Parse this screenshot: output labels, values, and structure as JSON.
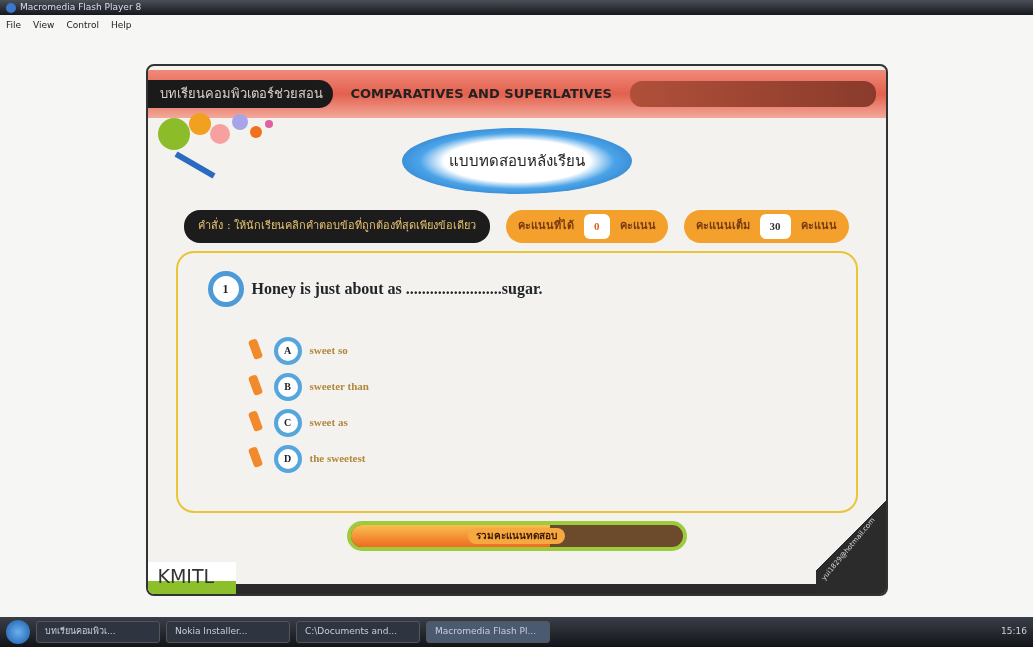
{
  "window": {
    "title": "Macromedia Flash Player 8"
  },
  "menu": [
    "File",
    "View",
    "Control",
    "Help"
  ],
  "header": {
    "tag": "บทเรียนคอมพิวเตอร์ช่วยสอน",
    "title": "COMPARATIVES AND SUPERLATIVES"
  },
  "section_title": "แบบทดสอบหลังเรียน",
  "instruction": "คำสั่ง : ให้นักเรียนคลิกคำตอบข้อที่ถูกต้องที่สุดเพียงข้อเดียว",
  "scores": [
    {
      "label": "คะแนนที่ได้",
      "value": "0",
      "unit": "คะแนน",
      "kind": "earned"
    },
    {
      "label": "คะแนนเต็ม",
      "value": "30",
      "unit": "คะแนน",
      "kind": "total"
    }
  ],
  "question": {
    "number": "1",
    "text": "Honey is just about as ........................sugar."
  },
  "options": [
    {
      "letter": "A",
      "text": "sweet so"
    },
    {
      "letter": "B",
      "text": "sweeter than"
    },
    {
      "letter": "C",
      "text": "sweet as"
    },
    {
      "letter": "D",
      "text": "the sweetest"
    }
  ],
  "progress": {
    "label": "รวมคะแนนทดสอบ",
    "level": 0.6
  },
  "footer": {
    "logo": "KMITL",
    "email": "yui1829@hotmail.com"
  },
  "taskbar": {
    "items": [
      {
        "label": "บทเรียนคอมพิวเ...",
        "selected": false
      },
      {
        "label": "Nokia Installer...",
        "selected": false
      },
      {
        "label": "C:\\Documents and...",
        "selected": false
      },
      {
        "label": "Macromedia Flash Pl...",
        "selected": true
      }
    ],
    "clock": "15:16"
  }
}
